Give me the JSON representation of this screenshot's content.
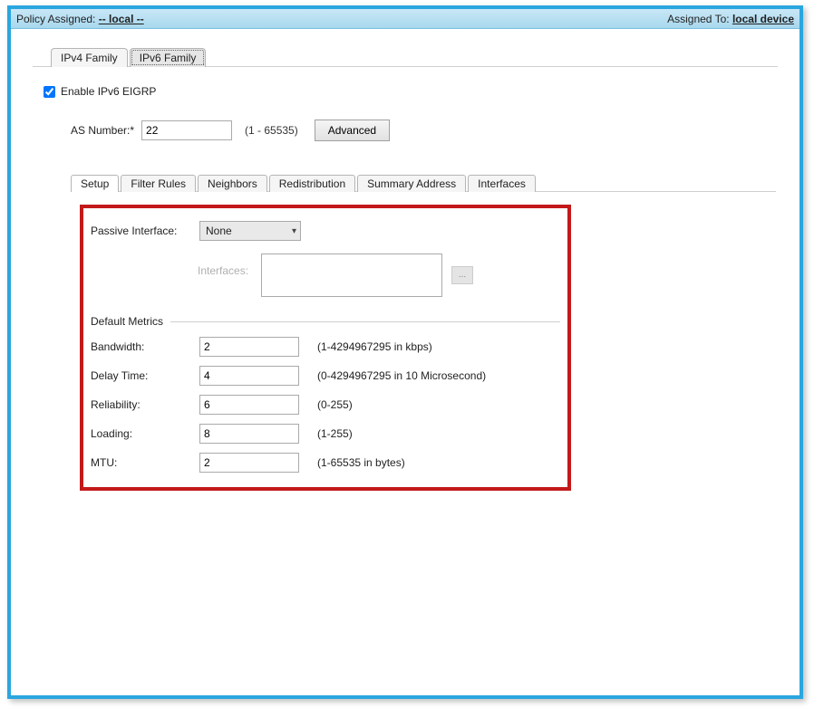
{
  "header": {
    "policy_assigned_label": "Policy Assigned:",
    "policy_assigned_value": "-- local --",
    "assigned_to_label": "Assigned To:",
    "assigned_to_value": "local device"
  },
  "outer_tabs": {
    "ipv4_label": "IPv4 Family",
    "ipv6_label": "IPv6 Family",
    "active_index": 1
  },
  "ipv6": {
    "enable_checkbox_label": "Enable IPv6 EIGRP",
    "enable_checked": true,
    "as_number_label": "AS Number:*",
    "as_number_value": "22",
    "as_number_range": "(1 - 65535)",
    "advanced_button": "Advanced"
  },
  "inner_tabs": {
    "items": [
      {
        "label": "Setup"
      },
      {
        "label": "Filter Rules"
      },
      {
        "label": "Neighbors"
      },
      {
        "label": "Redistribution"
      },
      {
        "label": "Summary Address"
      },
      {
        "label": "Interfaces"
      }
    ],
    "active_index": 0
  },
  "setup": {
    "passive_interface_label": "Passive Interface:",
    "passive_interface_value": "None",
    "interfaces_label": "Interfaces:",
    "browse_button": "...",
    "default_metrics_section": "Default Metrics",
    "metrics": [
      {
        "label": "Bandwidth:",
        "value": "2",
        "range": "(1-4294967295 in kbps)"
      },
      {
        "label": "Delay Time:",
        "value": "4",
        "range": "(0-4294967295 in 10 Microsecond)"
      },
      {
        "label": "Reliability:",
        "value": "6",
        "range": "(0-255)"
      },
      {
        "label": "Loading:",
        "value": "8",
        "range": "(1-255)"
      },
      {
        "label": "MTU:",
        "value": "2",
        "range": "(1-65535 in bytes)"
      }
    ]
  }
}
